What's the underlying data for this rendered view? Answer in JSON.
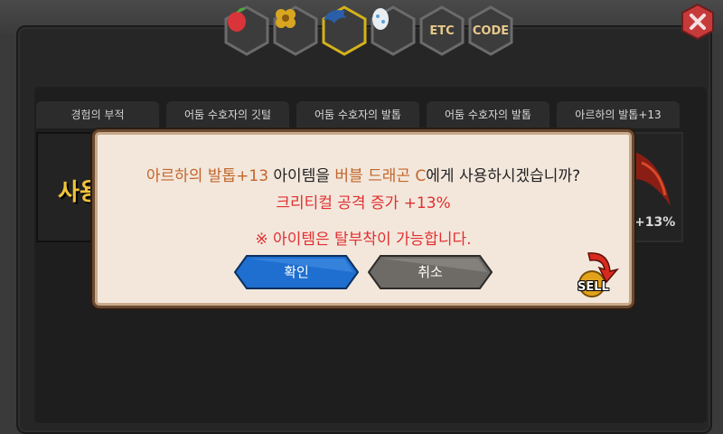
{
  "tabs": [
    {
      "name": "fruit-icon",
      "label": ""
    },
    {
      "name": "flower-icon",
      "label": ""
    },
    {
      "name": "claw-icon",
      "label": "",
      "selected": true
    },
    {
      "name": "egg-icon",
      "label": ""
    },
    {
      "name": "etc-tab",
      "label": "ETC"
    },
    {
      "name": "code-tab",
      "label": "CODE"
    }
  ],
  "items": [
    {
      "label": "경험의 부적",
      "big_text": "사용"
    },
    {
      "label": "어둠 수호자의 깃털"
    },
    {
      "label": "어둠 수호자의 발톱"
    },
    {
      "label": "어둠 수호자의 발톱"
    },
    {
      "label": "아르하의 발톱+13",
      "badge": "+13%"
    }
  ],
  "dialog": {
    "item_name": "아르하의 발톱+13",
    "text_a": " 아이템을 ",
    "target_name": "버블 드래곤 C",
    "text_b": "에게 사용하시겠습니까?",
    "effect": "크리티컬 공격 증가 +13%",
    "note": "※ 아이템은 탈부착이 가능합니다.",
    "confirm_label": "확인",
    "cancel_label": "취소",
    "sell_label": "SELL"
  },
  "colors": {
    "accent_orange": "#c2652a",
    "warning_red": "#e03030",
    "confirm_blue": "#1e6fd0",
    "cancel_gray": "#6e6a66",
    "tab_gold": "#e8c98a"
  }
}
